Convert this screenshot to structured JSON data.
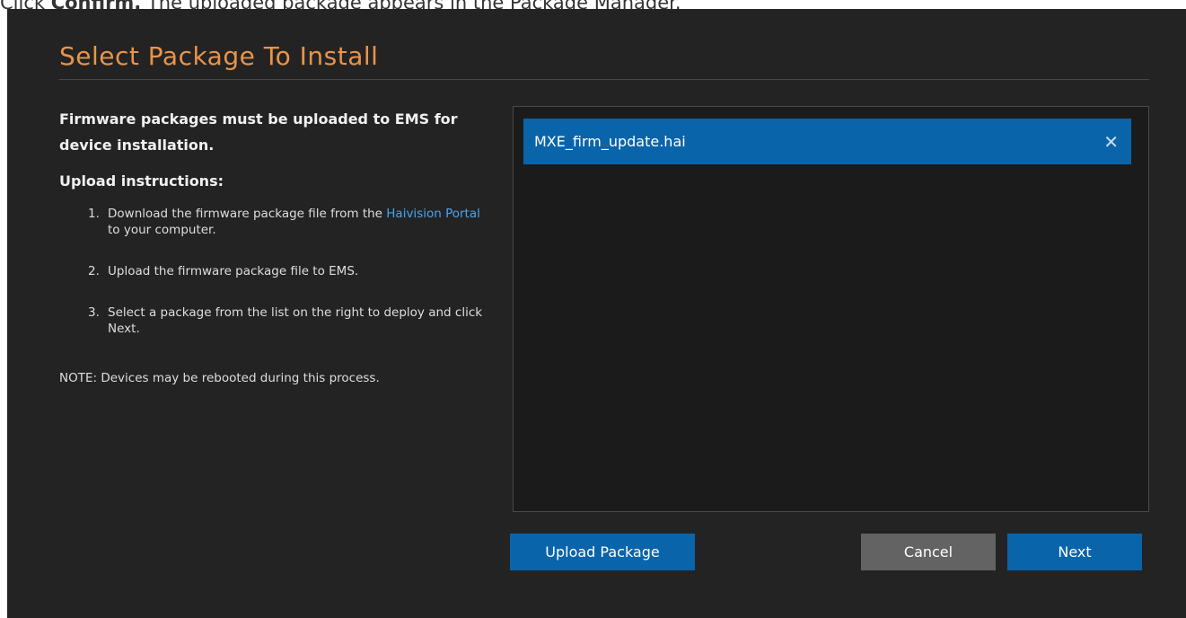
{
  "caption": {
    "prefix": "Click ",
    "bold": "Confirm.",
    "suffix": " The uploaded package appears in the Package Manager."
  },
  "dialog": {
    "title": "Select Package To Install",
    "intro": "Firmware packages must be uploaded to EMS for device installation.",
    "upload_heading": "Upload instructions:",
    "steps": [
      {
        "num": "1.",
        "before": "Download the firmware package file from the ",
        "link": "Haivision Portal",
        "after": " to your computer."
      },
      {
        "num": "2.",
        "text": "Upload the firmware package file to EMS."
      },
      {
        "num": "3.",
        "text": "Select a package from the list on the right to deploy and click Next."
      }
    ],
    "note": "NOTE: Devices may be rebooted during this process.",
    "packages": [
      {
        "name": "MXE_firm_update.hai",
        "remove_icon": "close-icon"
      }
    ],
    "buttons": {
      "upload": "Upload Package",
      "cancel": "Cancel",
      "next": "Next"
    }
  },
  "colors": {
    "background": "#232323",
    "title": "#e8944a",
    "accent": "#0a64aa",
    "link": "#4aa3ef",
    "cancel": "#636363"
  }
}
